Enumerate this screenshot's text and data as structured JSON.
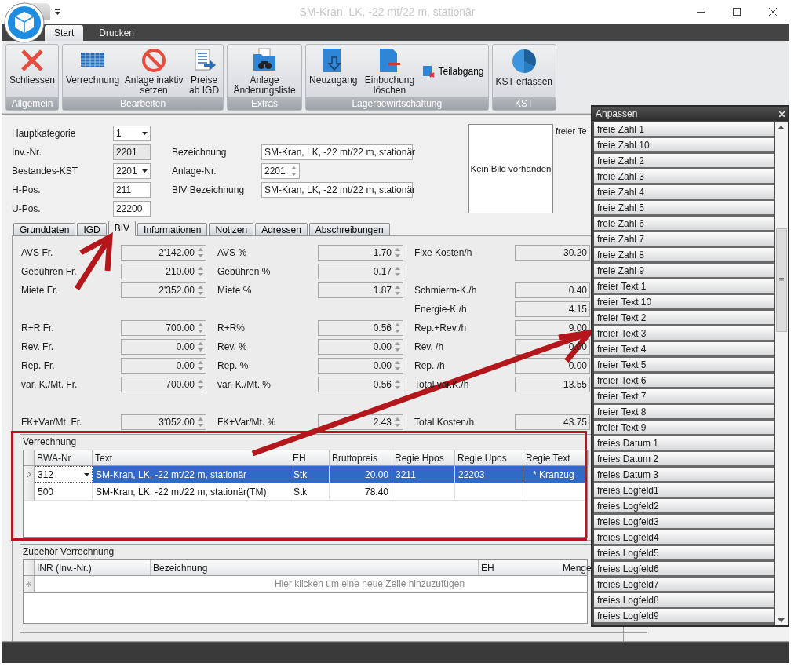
{
  "window": {
    "title": "SM-Kran, LK, -22 mt/22 m, stationär"
  },
  "ribbon": {
    "tabs": [
      {
        "label": "Start",
        "selected": true
      },
      {
        "label": "Drucken",
        "selected": false
      }
    ],
    "groups": [
      {
        "label": "Allgemein",
        "buttons": [
          {
            "label": "Schliessen",
            "kind": "large"
          }
        ]
      },
      {
        "label": "Bearbeiten",
        "buttons": [
          {
            "label": "Verrechnung",
            "kind": "large"
          },
          {
            "label": "Anlage inaktiv setzen",
            "kind": "large"
          },
          {
            "label": "Preise ab IGD",
            "kind": "large"
          }
        ]
      },
      {
        "label": "Extras",
        "buttons": [
          {
            "label": "Anlage Änderungsliste",
            "kind": "large"
          }
        ]
      },
      {
        "label": "Lagerbewirtschaftung",
        "buttons": [
          {
            "label": "Neuzugang",
            "kind": "large"
          },
          {
            "label": "Einbuchung löschen",
            "kind": "large"
          },
          {
            "label": "Teilabgang",
            "kind": "small"
          }
        ]
      },
      {
        "label": "KST",
        "buttons": [
          {
            "label": "KST erfassen",
            "kind": "large"
          }
        ]
      }
    ]
  },
  "form": {
    "rows": [
      {
        "left": {
          "label": "Hauptkategorie",
          "value": "1",
          "kind": "dropdown"
        }
      },
      {
        "left": {
          "label": "Inv.-Nr.",
          "value": "2201",
          "kind": "readonly"
        },
        "right": {
          "label": "Bezeichnung",
          "value": "SM-Kran, LK, -22 mt/22 m, stationär",
          "kind": "text"
        }
      },
      {
        "left": {
          "label": "Bestandes-KST",
          "value": "2201",
          "kind": "dropdown"
        },
        "right": {
          "label": "Anlage-Nr.",
          "value": "2201",
          "kind": "spin"
        }
      },
      {
        "left": {
          "label": "H-Pos.",
          "value": "211",
          "kind": "text"
        },
        "right": {
          "label": "BIV Bezeichnung",
          "value": "SM-Kran, LK, -22 mt/22 m, stationär",
          "kind": "text"
        }
      },
      {
        "left": {
          "label": "U-Pos.",
          "value": "22200",
          "kind": "text"
        }
      }
    ],
    "image_box": {
      "text": "Kein Bild vorhanden"
    },
    "side_label": "freier Te"
  },
  "detail_tabs": [
    {
      "label": "Grunddaten",
      "selected": false
    },
    {
      "label": "IGD",
      "selected": false
    },
    {
      "label": "BIV",
      "selected": true
    },
    {
      "label": "Informationen",
      "selected": false
    },
    {
      "label": "Notizen",
      "selected": false
    },
    {
      "label": "Adressen",
      "selected": false
    },
    {
      "label": "Abschreibungen",
      "selected": false
    }
  ],
  "biv": {
    "sections": [
      {
        "rows": [
          {
            "column_1": {
              "label": "AVS Fr.",
              "value": "2'142.00"
            },
            "column_2": {
              "label": "AVS %",
              "value": "1.70"
            },
            "column_3": {
              "label": "Fixe Kosten/h",
              "value": "30.20"
            }
          },
          {
            "column_1": {
              "label": "Gebühren Fr.",
              "value": "210.00"
            },
            "column_2": {
              "label": "Gebühren %",
              "value": "0.17"
            }
          },
          {
            "column_1": {
              "label": "Miete Fr.",
              "value": "2'352.00"
            },
            "column_2": {
              "label": "Miete %",
              "value": "1.87"
            },
            "column_3": {
              "label": "Schmierm-K./h",
              "value": "0.40"
            }
          },
          {
            "column_3": {
              "label": "Energie-K./h",
              "value": "4.15"
            }
          },
          {
            "column_1": {
              "label": "R+R Fr.",
              "value": "700.00"
            },
            "column_2": {
              "label": "R+R%",
              "value": "0.56"
            },
            "column_3": {
              "label": "Rep.+Rev./h",
              "value": "9.00"
            }
          },
          {
            "column_1": {
              "label": "Rev. Fr.",
              "value": "0.00"
            },
            "column_2": {
              "label": "Rev. %",
              "value": "0.00"
            },
            "column_3": {
              "label": "Rev. /h",
              "value": "0.00"
            }
          },
          {
            "column_1": {
              "label": "Rep. Fr.",
              "value": "0.00"
            },
            "column_2": {
              "label": "Rep. %",
              "value": "0.00"
            },
            "column_3": {
              "label": "Rep. /h",
              "value": "0.00"
            }
          },
          {
            "column_1": {
              "label": "var. K./Mt. Fr.",
              "value": "700.00"
            },
            "column_2": {
              "label": "var. K./Mt. %",
              "value": "0.56"
            },
            "column_3": {
              "label": "Total var.K./h",
              "value": "13.55"
            }
          }
        ]
      },
      {
        "rows": [
          {
            "column_1": {
              "label": "FK+Var/Mt. Fr.",
              "value": "3'052.00"
            },
            "column_2": {
              "label": "FK+Var/Mt. %",
              "value": "2.43"
            },
            "column_3": {
              "label": "Total Kosten/h",
              "value": "43.75"
            }
          }
        ]
      }
    ]
  },
  "verrechnung": {
    "title": "Verrechnung",
    "columns": [
      "BWA-Nr",
      "Text",
      "EH",
      "Bruttopreis",
      "Regie Hpos",
      "Regie Upos",
      "Regie Text"
    ],
    "rows": [
      {
        "selected": true,
        "editing": true,
        "cells": [
          "312",
          "SM-Kran, LK, -22 mt/22 m, stationär",
          "Stk",
          "20.00",
          "3211",
          "22203",
          "* Kranzug"
        ]
      },
      {
        "selected": false,
        "editing": false,
        "cells": [
          "500",
          "SM-Kran, LK, -22 mt/22 m, stationär(TM)",
          "Stk",
          "78.40"
        ]
      }
    ]
  },
  "zubehoer": {
    "title": "Zubehör Verrechnung",
    "columns": [
      "INR (Inv.-Nr.)",
      "Bezeichnung",
      "EH",
      "Menge"
    ],
    "new_row_hint": "Hier klicken um eine neue Zeile hinzuzufügen"
  },
  "customize_panel": {
    "title": "Anpassen",
    "items": [
      "freie Zahl 1",
      "freie Zahl 10",
      "freie Zahl 2",
      "freie Zahl 3",
      "freie Zahl 4",
      "freie Zahl 5",
      "freie Zahl 6",
      "freie Zahl 7",
      "freie Zahl 8",
      "freie Zahl 9",
      "freier Text 1",
      "freier Text 10",
      "freier Text 2",
      "freier Text 3",
      "freier Text 4",
      "freier Text 5",
      "freier Text 6",
      "freier Text 7",
      "freier Text 8",
      "freier Text 9",
      "freies Datum 1",
      "freies Datum 2",
      "freies Datum 3",
      "freies Logfeld1",
      "freies Logfeld2",
      "freies Logfeld3",
      "freies Logfeld4",
      "freies Logfeld5",
      "freies Logfeld6",
      "freies Logfeld7",
      "freies Logfeld8",
      "freies Logfeld9"
    ]
  }
}
